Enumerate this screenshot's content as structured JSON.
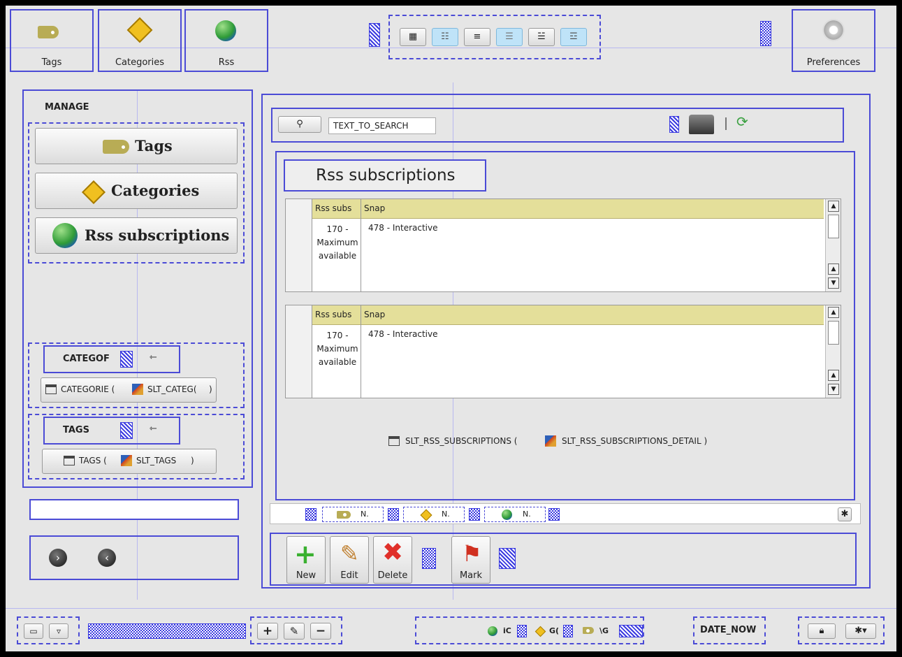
{
  "toolbar": {
    "tags_label": "Tags",
    "categories_label": "Categories",
    "rss_label": "Rss",
    "preferences_label": "Preferences",
    "view_modes": [
      "list-compact-icon",
      "list-details-icon",
      "list-lines-icon",
      "list-tiles-icon",
      "list-form-icon",
      "list-form-alt-icon"
    ]
  },
  "sidebar": {
    "heading": "MANAGE",
    "buttons": [
      {
        "label": "Tags",
        "icon": "tag-icon"
      },
      {
        "label": "Categories",
        "icon": "categories-icon"
      },
      {
        "label": "Rss subscriptions",
        "icon": "rss-globe-icon"
      }
    ],
    "categories_section": {
      "title": "CATEGOF",
      "expr_prefix": "CATEGORIE (",
      "expr_field": "SLT_CATEG(",
      "expr_suffix": ")"
    },
    "tags_section": {
      "title": "TAGS",
      "expr_prefix": "TAGS (",
      "expr_field": "SLT_TAGS",
      "expr_suffix": ")"
    }
  },
  "search": {
    "value": "TEXT_TO_SEARCH"
  },
  "panel": {
    "title": "Rss subscriptions",
    "tables": [
      {
        "col1": "Rss subs",
        "col2": "Snap",
        "row_value": "170 -\nMaximum\navailable",
        "row_snap": "478 - Interactive"
      },
      {
        "col1": "Rss subs",
        "col2": "Snap",
        "row_value": "170 -\nMaximum\navailable",
        "row_snap": "478 - Interactive"
      }
    ],
    "formula_table": "SLT_RSS_SUBSCRIPTIONS (",
    "formula_detail": "SLT_RSS_SUBSCRIPTIONS_DETAIL )"
  },
  "nav_strip": {
    "items": [
      "N.",
      "N.",
      "N."
    ]
  },
  "actions": {
    "new": "New",
    "edit": "Edit",
    "delete": "Delete",
    "mark": "Mark"
  },
  "statusbar": {
    "plus": "+",
    "minus": "−",
    "mini_labels": [
      "iC",
      "G(",
      "\\G"
    ],
    "date": "DATE_NOW"
  },
  "colors": {
    "accent": "#4b4bd6",
    "header_yellow": "#e4df9a",
    "bg": "#e6e6e6"
  }
}
